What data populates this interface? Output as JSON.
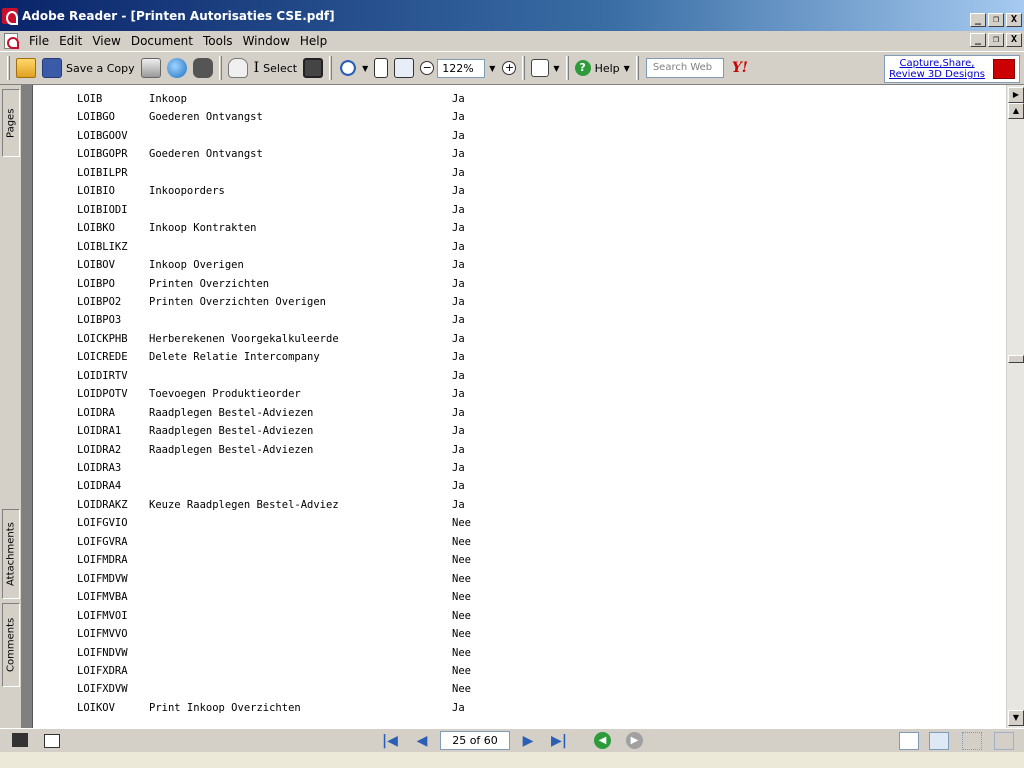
{
  "window": {
    "title": "Adobe Reader - [Printen Autorisaties CSE.pdf]",
    "buttons": [
      "_",
      "❐",
      "X"
    ]
  },
  "menu": {
    "items": [
      "File",
      "Edit",
      "View",
      "Document",
      "Tools",
      "Window",
      "Help"
    ]
  },
  "toolbar": {
    "save_copy_label": "Save a Copy",
    "select_label": "Select",
    "zoom_value": "122%",
    "help_label": "Help",
    "search_placeholder": "Search Web",
    "yahoo_label": "Y!",
    "promo_text": "Capture,Share, Review 3D Designs"
  },
  "side_tabs": [
    "Pages",
    "Attachments",
    "Comments"
  ],
  "document": {
    "rows": [
      {
        "code": "LOIB",
        "desc": "Inkoop",
        "value": "Ja"
      },
      {
        "code": "LOIBGO",
        "desc": "Goederen Ontvangst",
        "value": "Ja"
      },
      {
        "code": "LOIBGOOV",
        "desc": "",
        "value": "Ja"
      },
      {
        "code": "LOIBGOPR",
        "desc": "Goederen Ontvangst",
        "value": "Ja"
      },
      {
        "code": "LOIBILPR",
        "desc": "",
        "value": "Ja"
      },
      {
        "code": "LOIBIO",
        "desc": "Inkooporders",
        "value": "Ja"
      },
      {
        "code": "LOIBIODI",
        "desc": "",
        "value": "Ja"
      },
      {
        "code": "LOIBKO",
        "desc": "Inkoop Kontrakten",
        "value": "Ja"
      },
      {
        "code": "LOIBLIKZ",
        "desc": "",
        "value": "Ja"
      },
      {
        "code": "LOIBOV",
        "desc": "Inkoop Overigen",
        "value": "Ja"
      },
      {
        "code": "LOIBPO",
        "desc": "Printen Overzichten",
        "value": "Ja"
      },
      {
        "code": "LOIBPO2",
        "desc": "Printen Overzichten Overigen",
        "value": "Ja"
      },
      {
        "code": "LOIBPO3",
        "desc": "",
        "value": "Ja"
      },
      {
        "code": "LOICKPHB",
        "desc": "Herberekenen Voorgekalkuleerde",
        "value": "Ja"
      },
      {
        "code": "LOICREDE",
        "desc": "Delete Relatie Intercompany",
        "value": "Ja"
      },
      {
        "code": "LOIDIRTV",
        "desc": "",
        "value": "Ja"
      },
      {
        "code": "LOIDPOTV",
        "desc": "Toevoegen Produktieorder",
        "value": "Ja"
      },
      {
        "code": "LOIDRA",
        "desc": "Raadplegen Bestel-Adviezen",
        "value": "Ja"
      },
      {
        "code": "LOIDRA1",
        "desc": "Raadplegen Bestel-Adviezen",
        "value": "Ja"
      },
      {
        "code": "LOIDRA2",
        "desc": "Raadplegen Bestel-Adviezen",
        "value": "Ja"
      },
      {
        "code": "LOIDRA3",
        "desc": "",
        "value": "Ja"
      },
      {
        "code": "LOIDRA4",
        "desc": "",
        "value": "Ja"
      },
      {
        "code": "LOIDRAKZ",
        "desc": "Keuze Raadplegen Bestel-Adviez",
        "value": "Ja"
      },
      {
        "code": "LOIFGVIO",
        "desc": "",
        "value": "Nee"
      },
      {
        "code": "LOIFGVRA",
        "desc": "",
        "value": "Nee"
      },
      {
        "code": "LOIFMDRA",
        "desc": "",
        "value": "Nee"
      },
      {
        "code": "LOIFMDVW",
        "desc": "",
        "value": "Nee"
      },
      {
        "code": "LOIFMVBA",
        "desc": "",
        "value": "Nee"
      },
      {
        "code": "LOIFMVOI",
        "desc": "",
        "value": "Nee"
      },
      {
        "code": "LOIFMVVO",
        "desc": "",
        "value": "Nee"
      },
      {
        "code": "LOIFNDVW",
        "desc": "",
        "value": "Nee"
      },
      {
        "code": "LOIFXDRA",
        "desc": "",
        "value": "Nee"
      },
      {
        "code": "LOIFXDVW",
        "desc": "",
        "value": "Nee"
      },
      {
        "code": "LOIKOV",
        "desc": "Print Inkoop Overzichten",
        "value": "Ja"
      }
    ]
  },
  "status": {
    "page_indicator": "25 of 60"
  },
  "colors": {
    "title_bar": "#0a246a",
    "chrome": "#d4d0c8",
    "nav_arrow": "#2b5fb5",
    "back_button": "#2e9b3a",
    "forward_button": "#a0a0a0"
  }
}
